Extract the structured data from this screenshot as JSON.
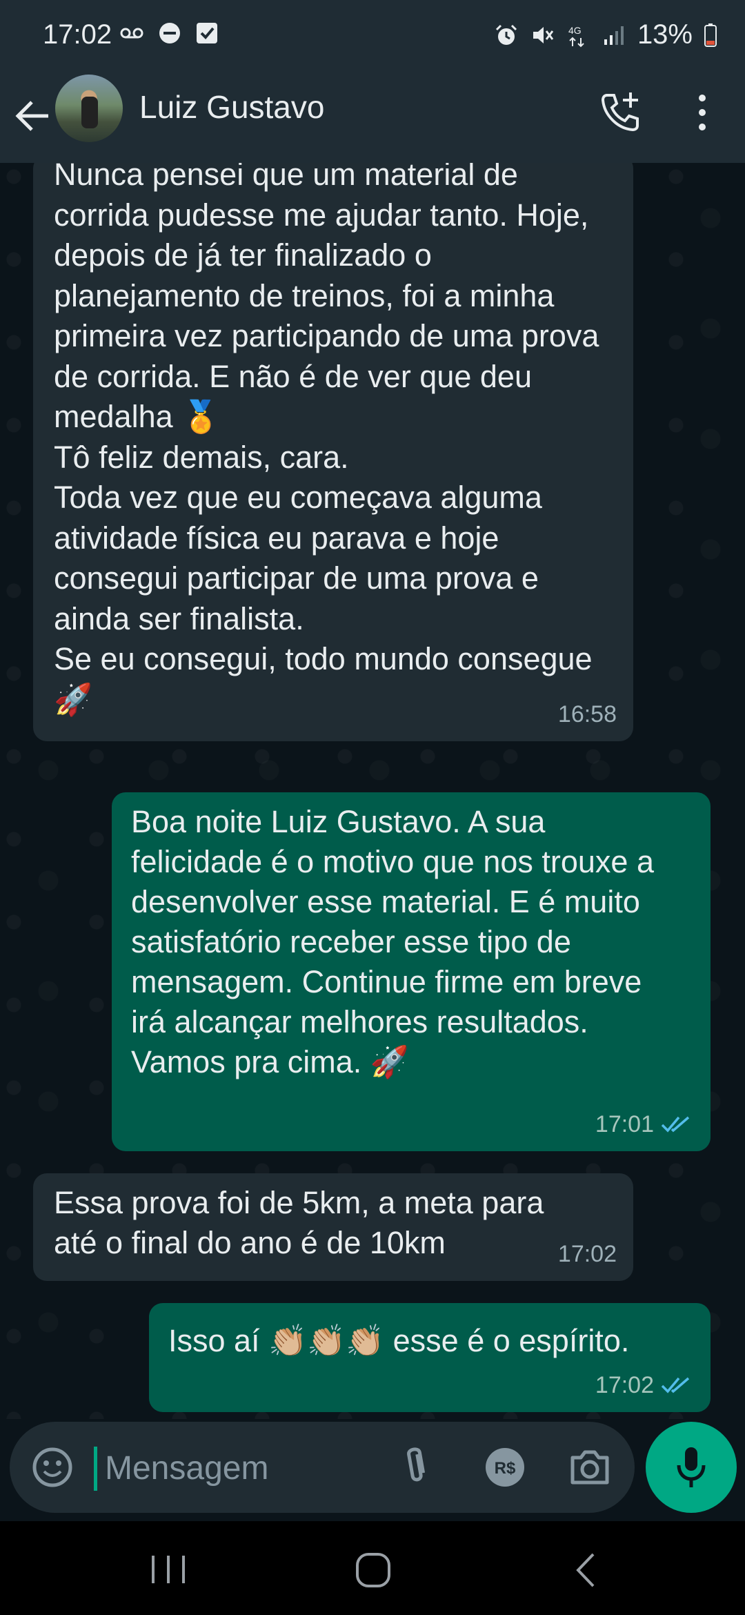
{
  "status_bar": {
    "time": "17:02",
    "battery": "13%",
    "icons": [
      "voicemail-icon",
      "dnd-icon",
      "check-box-icon",
      "alarm-icon",
      "mute-icon",
      "4g-icon",
      "signal-icon",
      "battery-icon"
    ]
  },
  "header": {
    "contact_name": "Luiz Gustavo",
    "icons": [
      "back-arrow-icon",
      "avatar",
      "add-call-icon",
      "more-vert-icon"
    ]
  },
  "messages": [
    {
      "direction": "in",
      "text": "Nunca pensei que um material de corrida pudesse me ajudar tanto. Hoje, depois de já ter finalizado o planejamento de treinos, foi a minha primeira vez participando de uma prova de corrida. E não é de ver que deu medalha 🏅\nTô feliz demais, cara.\nToda vez que eu começava alguma atividade física eu parava e hoje consegui participar de uma prova e ainda ser finalista.\nSe eu consegui, todo mundo consegue 🚀",
      "time": "16:58"
    },
    {
      "direction": "out",
      "text": "Boa noite Luiz Gustavo. A sua felicidade é o motivo que nos trouxe a desenvolver esse material. E é muito satisfatório receber esse tipo de mensagem. Continue firme em breve irá alcançar melhores resultados. Vamos pra cima. 🚀",
      "time": "17:01",
      "status": "read"
    },
    {
      "direction": "in",
      "text": "Essa prova foi de 5km, a meta para até o final do ano é de 10km",
      "time": "17:02"
    },
    {
      "direction": "out",
      "text": "Isso aí 👏🏼👏🏼👏🏼 esse é o espírito.",
      "time": "17:02",
      "status": "read"
    }
  ],
  "composer": {
    "placeholder": "Mensagem",
    "icons": [
      "emoji-icon",
      "attach-icon",
      "payment-icon",
      "camera-icon",
      "mic-icon"
    ]
  },
  "colors": {
    "background": "#0b141a",
    "header": "#1f2c34",
    "incoming_bubble": "#202c33",
    "outgoing_bubble": "#005c4b",
    "accent": "#00a884",
    "read_ticks": "#53bdeb"
  }
}
